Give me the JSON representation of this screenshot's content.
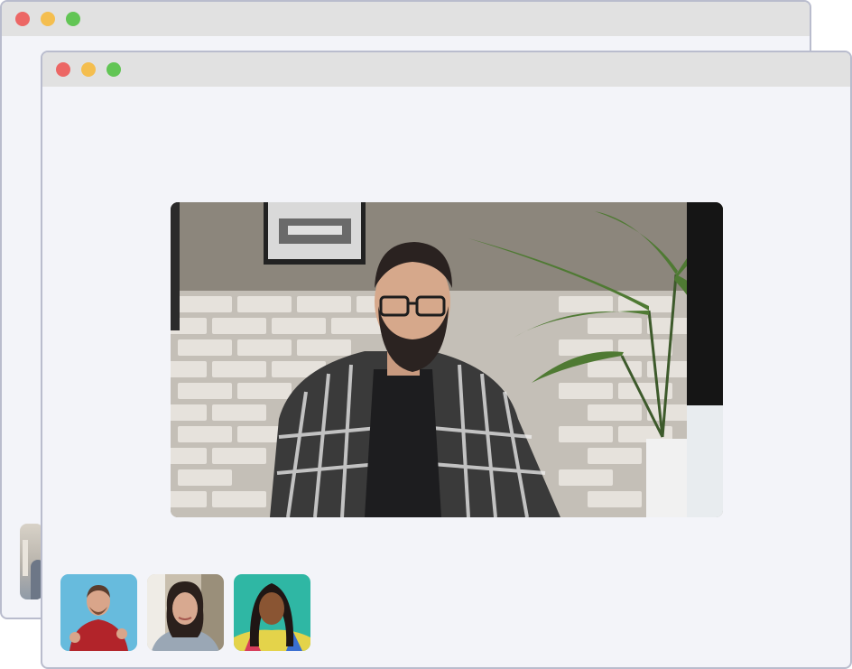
{
  "window_controls": {
    "close_color": "#ec6765",
    "minimize_color": "#f4be4f",
    "maximize_color": "#62c555"
  },
  "main_video": {
    "icon": "speaker-video-feed"
  },
  "participants": [
    {
      "icon": "participant-video-thumbnail",
      "background_color": "#5fb3d9"
    },
    {
      "icon": "participant-video-thumbnail",
      "background_color": "#c9bfae"
    },
    {
      "icon": "participant-video-thumbnail",
      "background_color": "#2fb7a4"
    }
  ]
}
